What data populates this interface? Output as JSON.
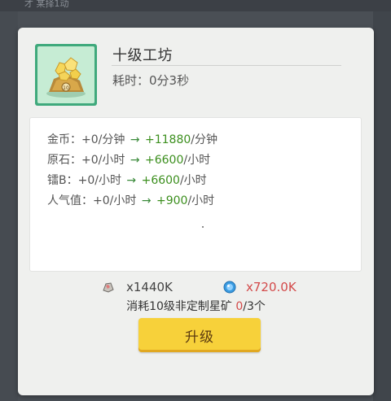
{
  "background": {
    "top_text": "才 某择1动"
  },
  "dialog": {
    "title": "十级工坊",
    "time_label": "耗时：",
    "time_value": "0分3秒",
    "icon": "golden-rock-workshop-icon",
    "stats": [
      {
        "label": "金币：",
        "old": "+0/分钟",
        "arrow": "→",
        "new": "+11880",
        "unit": "/分钟"
      },
      {
        "label": "原石：",
        "old": "+0/小时",
        "arrow": "→",
        "new": "+6600",
        "unit": "/小时"
      },
      {
        "label": "镭B：",
        "old": "+0/小时",
        "arrow": "→",
        "new": "+6600",
        "unit": "/小时"
      },
      {
        "label": "人气值：",
        "old": "+0/小时",
        "arrow": "→",
        "new": "+900",
        "unit": "/小时"
      }
    ],
    "cost": {
      "ore_icon": "ore-icon",
      "ore_amount": "x1440K",
      "coin_icon": "blue-coin-icon",
      "coin_amount": "x720.0K"
    },
    "consume": {
      "prefix": "消耗10级非定制星矿 ",
      "have": "0",
      "suffix": "/3个"
    },
    "upgrade_button": "升级"
  },
  "colors": {
    "green_value": "#3c8f1e",
    "red_value": "#d34a4a",
    "button": "#f7d13a"
  }
}
